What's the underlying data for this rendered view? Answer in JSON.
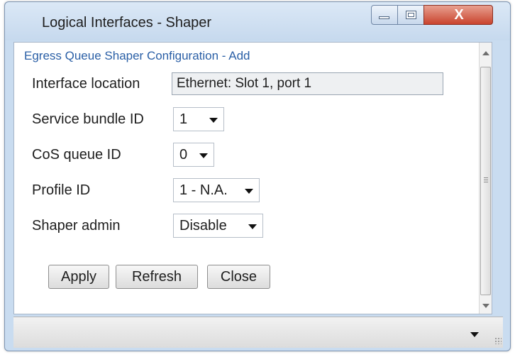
{
  "window": {
    "title": "Logical Interfaces - Shaper",
    "controls": {
      "minimize": "minimize",
      "maximize": "maximize",
      "close": "X"
    }
  },
  "form": {
    "heading": "Egress Queue Shaper Configuration - Add",
    "interface_location": {
      "label": "Interface location",
      "value": "Ethernet: Slot 1, port 1"
    },
    "service_bundle_id": {
      "label": "Service bundle ID",
      "value": "1"
    },
    "cos_queue_id": {
      "label": "CoS queue ID",
      "value": "0"
    },
    "profile_id": {
      "label": "Profile ID",
      "value": "1 - N.A."
    },
    "shaper_admin": {
      "label": "Shaper admin",
      "value": "Disable"
    }
  },
  "buttons": {
    "apply": "Apply",
    "refresh": "Refresh",
    "close": "Close"
  },
  "icons": {
    "minimize": "minimize-icon",
    "maximize": "maximize-icon",
    "close": "close-icon",
    "dropdown": "chevron-down-icon",
    "scroll_up": "scroll-up-arrow-icon",
    "scroll_down": "scroll-down-arrow-icon",
    "resize": "resize-grip-icon"
  },
  "colors": {
    "heading": "#2a5fa6",
    "close_button": "#c9432d",
    "titlebar": "#c9dcf0"
  }
}
